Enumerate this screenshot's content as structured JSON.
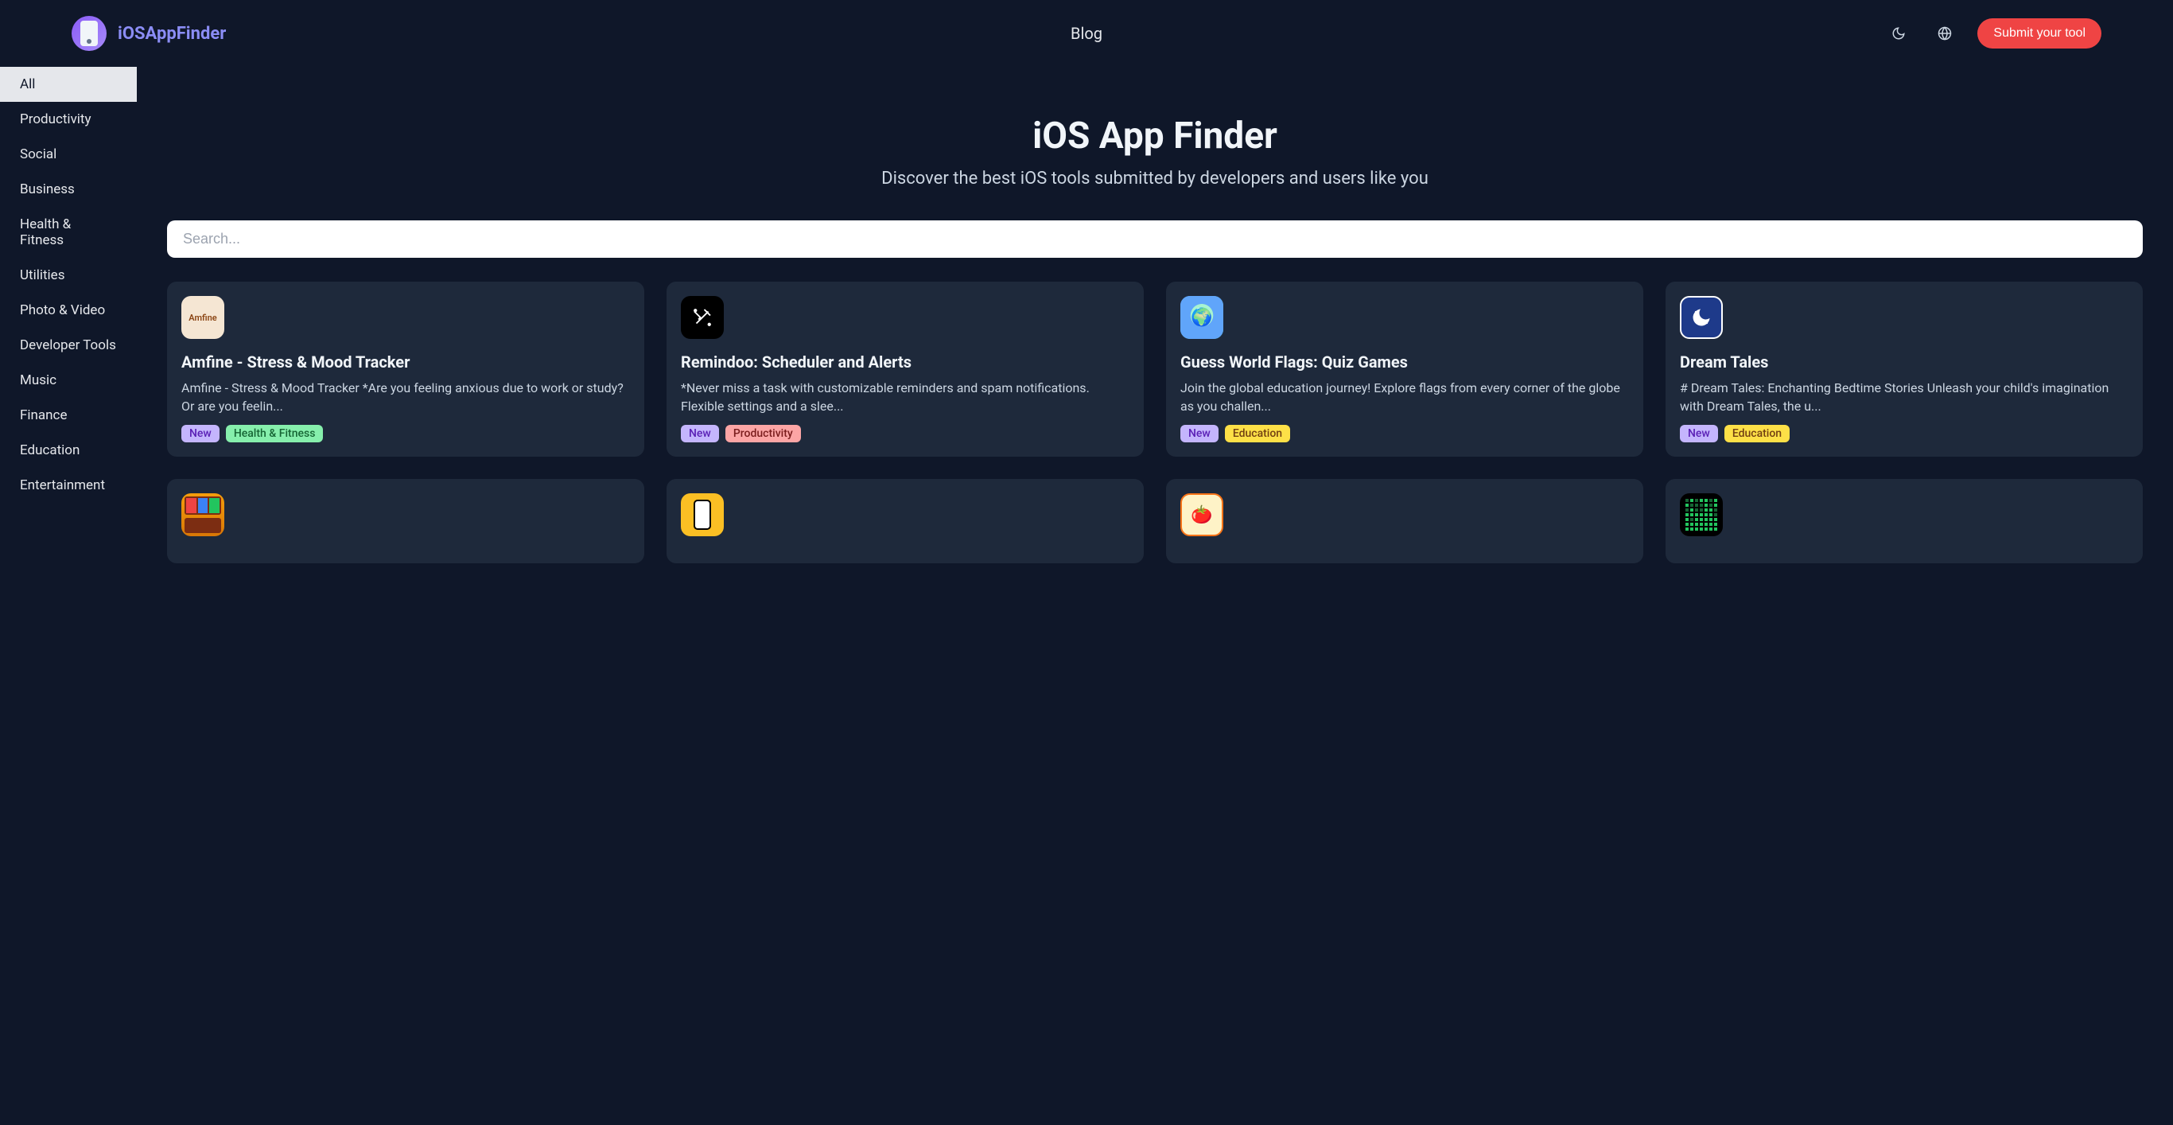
{
  "header": {
    "brand": "iOSAppFinder",
    "nav": {
      "blog": "Blog"
    },
    "submit": "Submit your tool"
  },
  "sidebar": {
    "items": [
      {
        "label": "All",
        "active": true
      },
      {
        "label": "Productivity",
        "active": false
      },
      {
        "label": "Social",
        "active": false
      },
      {
        "label": "Business",
        "active": false
      },
      {
        "label": "Health & Fitness",
        "active": false
      },
      {
        "label": "Utilities",
        "active": false
      },
      {
        "label": "Photo & Video",
        "active": false
      },
      {
        "label": "Developer Tools",
        "active": false
      },
      {
        "label": "Music",
        "active": false
      },
      {
        "label": "Finance",
        "active": false
      },
      {
        "label": "Education",
        "active": false
      },
      {
        "label": "Entertainment",
        "active": false
      }
    ]
  },
  "hero": {
    "title": "iOS App Finder",
    "subtitle": "Discover the best iOS tools submitted by developers and users like you"
  },
  "search": {
    "placeholder": "Search..."
  },
  "apps": [
    {
      "title": "Amfine - Stress & Mood Tracker",
      "desc": "Amfine - Stress & Mood Tracker *Are you feeling anxious due to work or study? Or are you feelin...",
      "tags": [
        {
          "label": "New",
          "cls": "tag-new"
        },
        {
          "label": "Health & Fitness",
          "cls": "tag-health"
        }
      ],
      "iconKey": "amfine"
    },
    {
      "title": "Remindoo: Scheduler and Alerts",
      "desc": "*Never miss a task with customizable reminders and spam notifications. Flexible settings and a slee...",
      "tags": [
        {
          "label": "New",
          "cls": "tag-new"
        },
        {
          "label": "Productivity",
          "cls": "tag-productivity"
        }
      ],
      "iconKey": "remindoo"
    },
    {
      "title": "Guess World Flags: Quiz Games",
      "desc": "Join the global education journey! Explore flags from every corner of the globe as you challen...",
      "tags": [
        {
          "label": "New",
          "cls": "tag-new"
        },
        {
          "label": "Education",
          "cls": "tag-education"
        }
      ],
      "iconKey": "flags"
    },
    {
      "title": "Dream Tales",
      "desc": "# Dream Tales: Enchanting Bedtime Stories Unleash your child's imagination with Dream Tales, the u...",
      "tags": [
        {
          "label": "New",
          "cls": "tag-new"
        },
        {
          "label": "Education",
          "cls": "tag-education"
        }
      ],
      "iconKey": "dreamtales"
    },
    {
      "title": "",
      "desc": "",
      "tags": [],
      "iconKey": "shelf"
    },
    {
      "title": "",
      "desc": "",
      "tags": [],
      "iconKey": "phone"
    },
    {
      "title": "",
      "desc": "",
      "tags": [],
      "iconKey": "recipe"
    },
    {
      "title": "",
      "desc": "",
      "tags": [],
      "iconKey": "habit"
    }
  ]
}
